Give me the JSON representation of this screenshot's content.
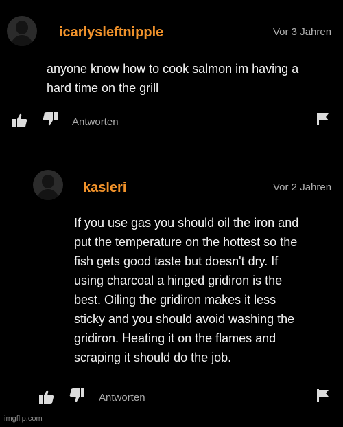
{
  "comments": [
    {
      "username": "icarlysleftnipple",
      "timestamp": "Vor 3 Jahren",
      "text": "anyone know how to cook salmon im having a\nhard time on the grill",
      "reply_label": "Antworten"
    },
    {
      "username": "kasleri",
      "timestamp": "Vor 2 Jahren",
      "text": "If you use gas you should oil the iron and\nput the temperature on the hottest so the\nfish gets good taste but doesn't dry. If\nusing charcoal a hinged gridiron is the\nbest. Oiling the gridiron makes it less\nsticky and you should avoid washing the\ngridiron. Heating it on the flames and\nscraping it should do the job.",
      "reply_label": "Antworten"
    }
  ],
  "watermark": "imgflip.com",
  "icons": {
    "like": "thumbs-up-icon",
    "dislike": "thumbs-down-icon",
    "report": "flag-icon",
    "avatar": "default-avatar-icon"
  },
  "colors": {
    "background": "#000000",
    "username": "#f0922b",
    "text": "#f2f2f2",
    "meta": "#b0b0b0"
  }
}
